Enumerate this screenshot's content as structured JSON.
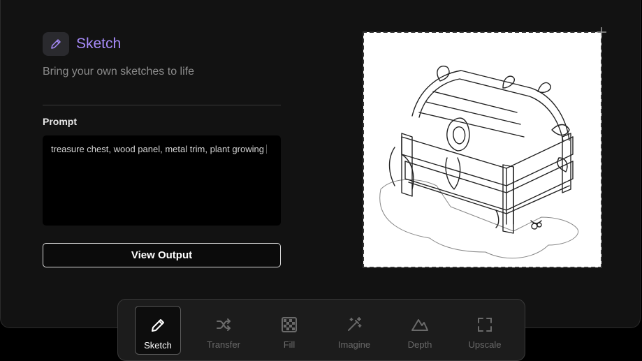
{
  "header": {
    "title": "Sketch",
    "subtitle": "Bring your own sketches to life",
    "icon": "pencil-icon"
  },
  "prompt": {
    "label": "Prompt",
    "value": "treasure chest, wood panel, metal trim, plant growing"
  },
  "actions": {
    "view_output": "View Output"
  },
  "canvas": {
    "content": "sketch of a treasure chest with plants growing around it"
  },
  "toolbar": {
    "active": "Sketch",
    "tools": [
      {
        "label": "Sketch",
        "icon": "pencil-icon"
      },
      {
        "label": "Transfer",
        "icon": "shuffle-icon"
      },
      {
        "label": "Fill",
        "icon": "checkerboard-icon"
      },
      {
        "label": "Imagine",
        "icon": "magic-wand-icon"
      },
      {
        "label": "Depth",
        "icon": "mountain-icon"
      },
      {
        "label": "Upscale",
        "icon": "expand-icon"
      }
    ]
  },
  "colors": {
    "accent": "#a78bfa",
    "background": "#121212"
  }
}
